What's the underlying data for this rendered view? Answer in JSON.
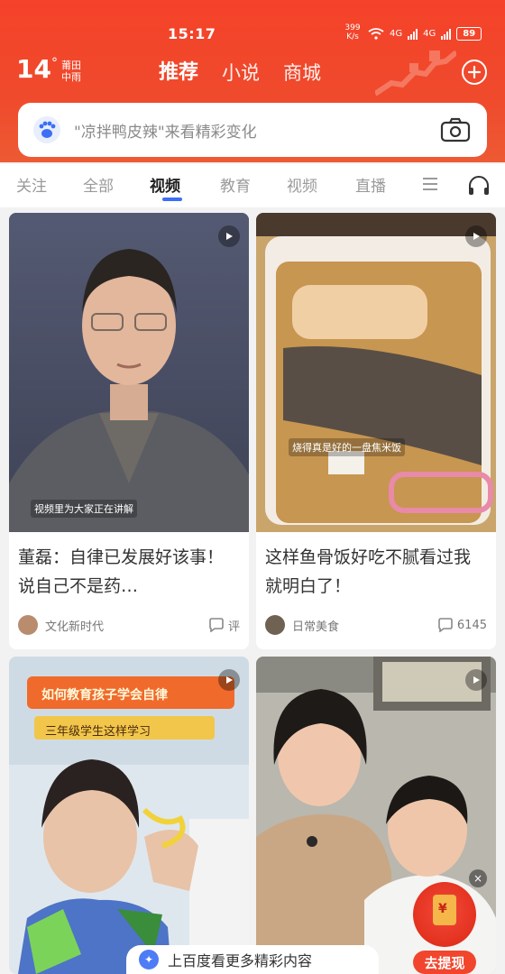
{
  "status_bar": {
    "time": "15:17",
    "net_speed": "399 K/s",
    "network": "4G",
    "battery": "89"
  },
  "weather": {
    "temperature": "14",
    "degree": "°",
    "location": "莆田",
    "condition": "中雨"
  },
  "top_nav": {
    "tabs": [
      {
        "label": "推荐",
        "active": true
      },
      {
        "label": "小说",
        "active": false
      },
      {
        "label": "商城",
        "active": false
      }
    ]
  },
  "search": {
    "placeholder": "\"凉拌鸭皮辣\"来看精彩变化"
  },
  "channels": {
    "items": [
      {
        "label": "关注",
        "active": false
      },
      {
        "label": "全部",
        "active": false
      },
      {
        "label": "视频",
        "active": true
      },
      {
        "label": "教育",
        "active": false
      },
      {
        "label": "视频",
        "active": false
      },
      {
        "label": "直播",
        "active": false
      }
    ]
  },
  "feed": {
    "cards": [
      {
        "caption": "视频里为大家正在讲解",
        "title": "董磊：自律已发展好该事！说自己不是药…",
        "author": "文化新时代",
        "comments": "评"
      },
      {
        "caption": "烧得真是好的一盘焦米饭",
        "title": "这样鱼骨饭好吃不腻看过我就明白了！",
        "author": "日常美食",
        "comments": "6145"
      },
      {
        "caption": "如何教育孩子学会自律",
        "caption2": "三年级学生这样学习",
        "title": "",
        "author": "",
        "comments": ""
      },
      {
        "caption": "",
        "title": "",
        "author": "",
        "comments": ""
      }
    ]
  },
  "floating": {
    "withdraw_label": "去提现",
    "close_label": "×",
    "toast_text": "上百度看更多精彩内容"
  },
  "colors": {
    "header_red": "#f5422a",
    "accent_blue": "#3d6ff5",
    "withdraw_red": "#f1462d"
  }
}
